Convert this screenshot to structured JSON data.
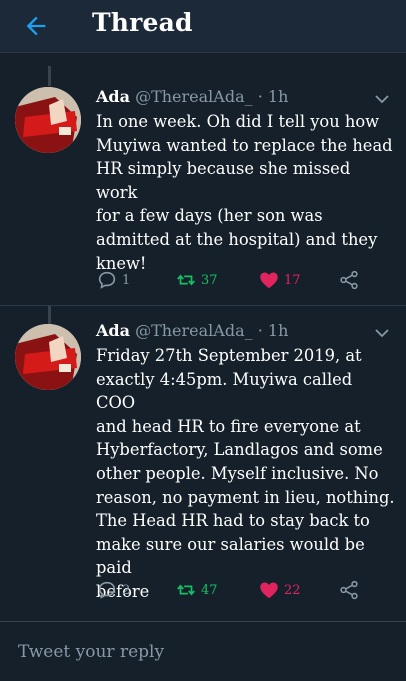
{
  "header": {
    "title": "Thread"
  },
  "tweets": [
    {
      "name": "Ada",
      "handle": "@TherealAda_",
      "dot": "·",
      "time": "1h",
      "lines": [
        "In one week. Oh did I tell you how",
        "Muyiwa wanted to replace the head",
        "HR simply because she missed work",
        "for a few days (her son was",
        "admitted at the hospital) and they",
        "knew!"
      ],
      "replies": "1",
      "retweets": "37",
      "likes": "17"
    },
    {
      "name": "Ada",
      "handle": "@TherealAda_",
      "dot": "·",
      "time": "1h",
      "lines": [
        "Friday 27th September 2019, at",
        "exactly 4:45pm. Muyiwa called COO",
        "and head HR to fire everyone at",
        "Hyberfactory, Landlagos and some",
        "other people. Myself inclusive. No",
        "reason, no payment in lieu, nothing.",
        "The Head HR had to stay back to",
        "make sure our salaries would be paid",
        "before"
      ],
      "replies": "2",
      "retweets": "47",
      "likes": "22"
    }
  ],
  "reply": {
    "placeholder": "Tweet your reply"
  },
  "colors": {
    "background": "#15202b",
    "header": "#1c2938",
    "accent": "#1da1f2",
    "retweet": "#17bf63",
    "like": "#e0245e",
    "muted": "#8899a6"
  },
  "icons": {
    "back": "arrow-left-icon",
    "caret": "chevron-down-icon",
    "reply": "comment-icon",
    "retweet": "retweet-icon",
    "like": "heart-icon",
    "share": "share-icon"
  }
}
